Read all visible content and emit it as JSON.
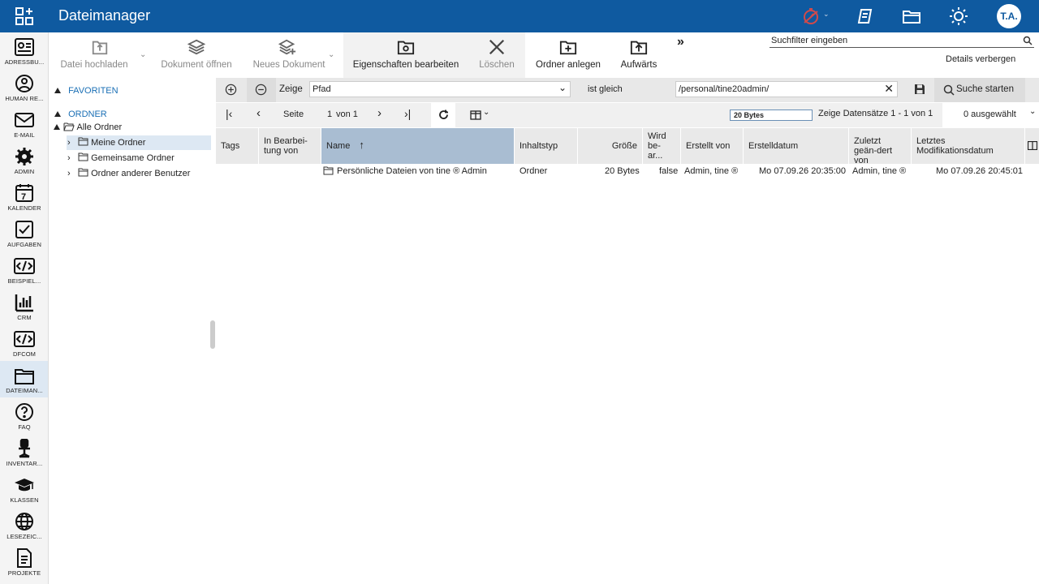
{
  "app": {
    "title": "Dateimanager",
    "avatar_initials": "T.A.",
    "accent": "#0f5aa0"
  },
  "nav": [
    {
      "label": "ADRESSBU...",
      "icon": "address-book-icon"
    },
    {
      "label": "HUMAN RE...",
      "icon": "person-icon"
    },
    {
      "label": "E-MAIL",
      "icon": "mail-icon"
    },
    {
      "label": "ADMIN",
      "icon": "gear-icon"
    },
    {
      "label": "KALENDER",
      "icon": "calendar-icon"
    },
    {
      "label": "AUFGABEN",
      "icon": "checkbox-icon"
    },
    {
      "label": "BEISPIEL...",
      "icon": "code-icon"
    },
    {
      "label": "CRM",
      "icon": "bar-chart-icon"
    },
    {
      "label": "DFCOM",
      "icon": "code-icon"
    },
    {
      "label": "DATEIMAN...",
      "icon": "folder-icon"
    },
    {
      "label": "FAQ",
      "icon": "question-icon"
    },
    {
      "label": "INVENTAR...",
      "icon": "chair-icon"
    },
    {
      "label": "KLASSEN",
      "icon": "graduation-cap-icon"
    },
    {
      "label": "LESEZEIC...",
      "icon": "globe-icon"
    },
    {
      "label": "PROJEKTE",
      "icon": "document-icon"
    }
  ],
  "toolbar": {
    "upload": "Datei hochladen",
    "open": "Dokument öffnen",
    "new_doc": "Neues Dokument",
    "edit_props": "Eigenschaften bearbeiten",
    "delete": "Löschen",
    "new_folder": "Ordner anlegen",
    "up": "Aufwärts",
    "search_placeholder": "Suchfilter eingeben",
    "details": "Details verbergen"
  },
  "tree": {
    "favorites": "FAVORITEN",
    "folders": "ORDNER",
    "all": "Alle Ordner",
    "mine": "Meine Ordner",
    "shared": "Gemeinsame Ordner",
    "others": "Ordner anderer Benutzer"
  },
  "filter": {
    "show_label": "Zeige",
    "field": "Pfad",
    "operator": "ist gleich",
    "value": "/personal/tine20admin/",
    "search_button": "Suche starten"
  },
  "pager": {
    "page_label": "Seite",
    "page": "1",
    "of": "von 1",
    "size_badge": "20 Bytes",
    "records": "Zeige Datensätze 1 - 1 von 1",
    "selected": "0 ausgewählt"
  },
  "columns": {
    "tags": "Tags",
    "editing": "In Bearbei-tung von",
    "name": "Name",
    "type": "Inhaltstyp",
    "size": "Größe",
    "being_edited": "Wird be-ar...",
    "created_by": "Erstellt von",
    "created": "Erstelldatum",
    "modified_by": "Zuletzt geän-dert von",
    "modified": "Letztes Modifikationsdatum"
  },
  "rows": [
    {
      "name": "Persönliche Dateien von tine ® Admin",
      "type": "Ordner",
      "size": "20 Bytes",
      "being_edited": "false",
      "created_by": "Admin, tine ®",
      "created": "Mo 07.09.26 20:35:00",
      "modified_by": "Admin, tine ®",
      "modified": "Mo 07.09.26 20:45:01"
    }
  ]
}
